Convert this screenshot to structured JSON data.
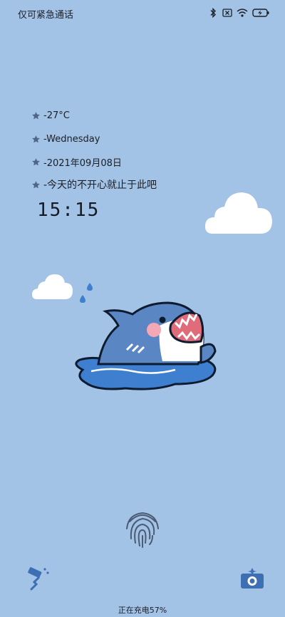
{
  "status_bar": {
    "carrier_text": "仅可紧急通话",
    "icons": [
      "bluetooth-icon",
      "no-sim-icon",
      "wifi-icon",
      "battery-charging-icon"
    ]
  },
  "info": {
    "temperature": "-27°C",
    "weekday": "-Wednesday",
    "date": "-2021年09月08日",
    "message": "-今天的不开心就止于此吧"
  },
  "clock": {
    "time": "15:15"
  },
  "bottom": {
    "charging_text": "正在充电57%",
    "left_shortcut_icon": "paint-roller-icon",
    "right_shortcut_icon": "camera-icon",
    "fingerprint_icon": "fingerprint-icon"
  },
  "colors": {
    "background": "#a2c2e6",
    "shark_body": "#5b86c4",
    "water": "#3f7fd0",
    "icon_blue": "#3d6fb3"
  }
}
